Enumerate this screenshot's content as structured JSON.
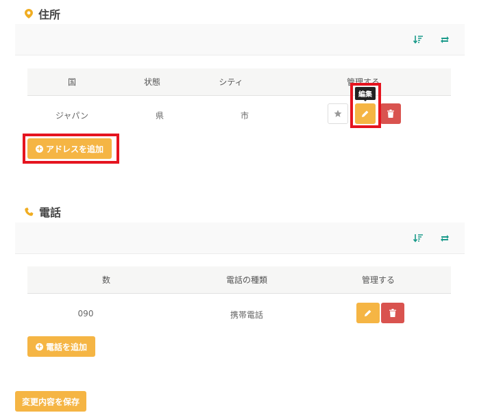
{
  "address": {
    "title": "住所",
    "icon": "map-pin-icon",
    "columns": [
      "国",
      "状態",
      "シティ",
      "管理する"
    ],
    "rows": [
      {
        "country": "ジャパン",
        "state": "県",
        "city": "市"
      }
    ],
    "tooltip": "編集",
    "add_label": "アドレスを追加"
  },
  "phone": {
    "title": "電話",
    "icon": "phone-icon",
    "columns": [
      "数",
      "電話の種類",
      "管理する"
    ],
    "rows": [
      {
        "number": "090",
        "type": "携帯電話"
      }
    ],
    "add_label": "電話を追加"
  },
  "save_label": "変更内容を保存",
  "colors": {
    "accent": "#f5b544",
    "danger": "#d9534f",
    "teal": "#1a9a8a",
    "highlight": "#e5141f"
  }
}
